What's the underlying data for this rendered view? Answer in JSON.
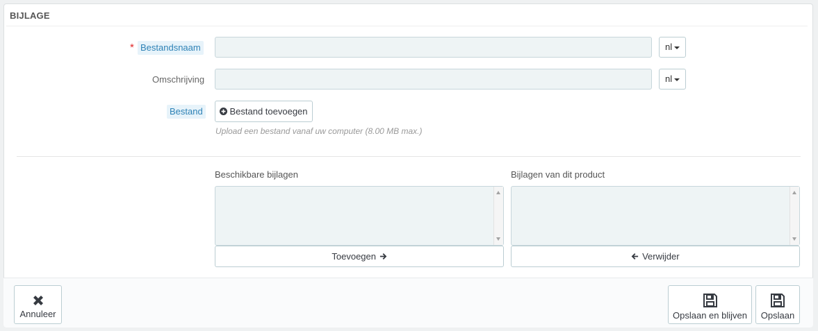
{
  "panel": {
    "title": "BIJLAGE"
  },
  "form": {
    "filename": {
      "label": "Bestandsnaam",
      "required_mark": "*",
      "value": "",
      "lang": "nl"
    },
    "description": {
      "label": "Omschrijving",
      "value": "",
      "lang": "nl"
    },
    "file": {
      "label": "Bestand",
      "button": "Bestand toevoegen",
      "hint": "Upload een bestand vanaf uw computer (8.00 MB max.)"
    }
  },
  "attachments": {
    "available_label": "Beschikbare bijlagen",
    "product_label": "Bijlagen van dit product",
    "add_button": "Toevoegen",
    "remove_button": "Verwijder"
  },
  "footer": {
    "cancel": "Annuleer",
    "save_stay": "Opslaan en blijven",
    "save": "Opslaan"
  },
  "icons": {
    "add_file": "plus-circle-icon",
    "arrow_right": "arrow-right-icon",
    "arrow_left": "arrow-left-icon",
    "cancel": "close-icon",
    "save": "floppy-disk-icon"
  }
}
